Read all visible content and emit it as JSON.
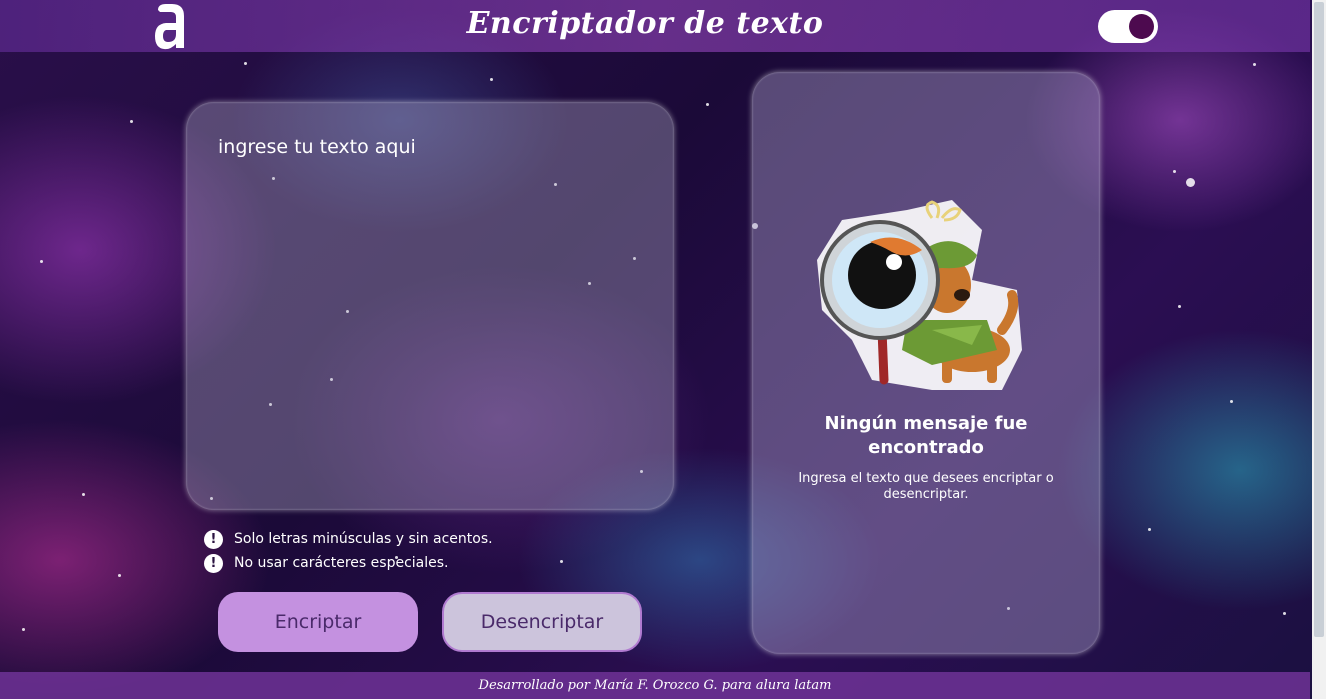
{
  "header": {
    "title": "Encriptador de texto",
    "logo_icon": "alura-a-logo",
    "theme_toggle_icon": "dark-mode-toggle"
  },
  "input": {
    "placeholder": "ingrese tu texto aqui"
  },
  "rules": [
    {
      "icon": "warning-icon",
      "text": "Solo letras minúsculas y sin acentos."
    },
    {
      "icon": "warning-icon",
      "text": "No usar carácteres especiales."
    }
  ],
  "buttons": {
    "encrypt_label": "Encriptar",
    "decrypt_label": "Desencriptar"
  },
  "output": {
    "image_icon": "detective-dog-icon",
    "title_line1": "Ningún mensaje fue",
    "title_line2": "encontrado",
    "description": "Ingresa el texto que desees encriptar o desencriptar."
  },
  "footer": {
    "credit": "Desarrollado por María F. Orozco G. para alura latam"
  },
  "colors": {
    "encrypt_button": "#c491e0",
    "decrypt_button": "#ccc4dc",
    "toggle_knob": "#4d0a4f"
  }
}
